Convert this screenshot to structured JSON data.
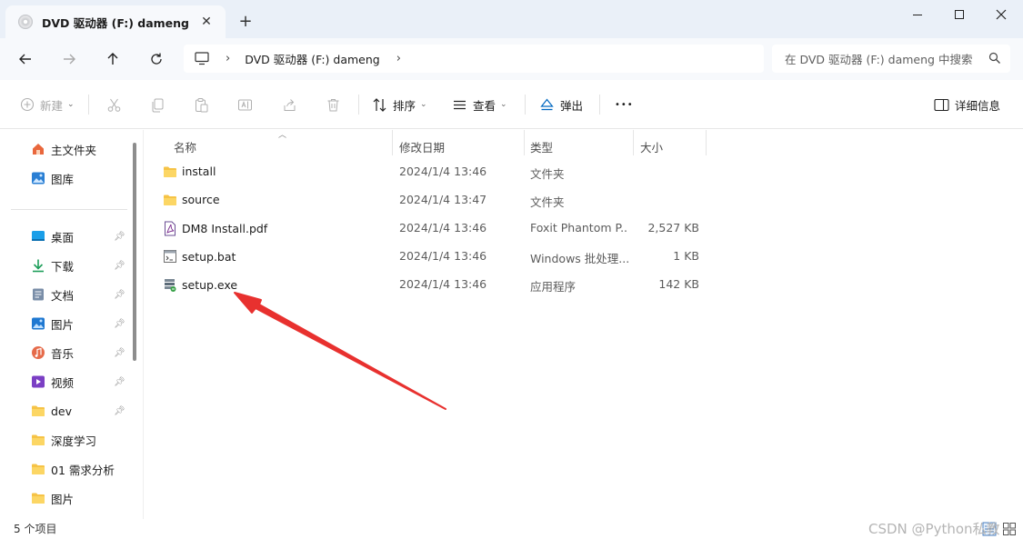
{
  "window": {
    "tab_title": "DVD 驱动器 (F:) dameng",
    "new_tab": "+",
    "close_tab": "✕"
  },
  "address": {
    "crumb": "DVD 驱动器 (F:) dameng",
    "search_placeholder": "在 DVD 驱动器 (F:) dameng 中搜索"
  },
  "toolbar": {
    "new_label": "新建",
    "sort_label": "排序",
    "view_label": "查看",
    "eject_label": "弹出",
    "more_label": "•••",
    "details_label": "详细信息"
  },
  "sidebar": {
    "top_items": [
      {
        "label": "主文件夹",
        "icon": "home-icon"
      },
      {
        "label": "图库",
        "icon": "gallery-icon"
      }
    ],
    "items": [
      {
        "label": "桌面",
        "icon": "desktop-icon",
        "pinned": true
      },
      {
        "label": "下载",
        "icon": "download-icon",
        "pinned": true
      },
      {
        "label": "文档",
        "icon": "document-icon",
        "pinned": true
      },
      {
        "label": "图片",
        "icon": "pictures-icon",
        "pinned": true
      },
      {
        "label": "音乐",
        "icon": "music-icon",
        "pinned": true
      },
      {
        "label": "视频",
        "icon": "video-icon",
        "pinned": true
      },
      {
        "label": "dev",
        "icon": "folder-icon",
        "pinned": true
      },
      {
        "label": "深度学习",
        "icon": "folder-icon",
        "pinned": false
      },
      {
        "label": "01 需求分析",
        "icon": "folder-icon",
        "pinned": false
      },
      {
        "label": "图片",
        "icon": "folder-icon",
        "pinned": false
      }
    ]
  },
  "columns": {
    "name": "名称",
    "date": "修改日期",
    "type": "类型",
    "size": "大小"
  },
  "files": [
    {
      "name": "install",
      "date": "2024/1/4 13:46",
      "type": "文件夹",
      "size": "",
      "icon": "folder-icon"
    },
    {
      "name": "source",
      "date": "2024/1/4 13:47",
      "type": "文件夹",
      "size": "",
      "icon": "folder-icon"
    },
    {
      "name": "DM8 Install.pdf",
      "date": "2024/1/4 13:46",
      "type": "Foxit Phantom P...",
      "size": "2,527 KB",
      "icon": "pdf-icon"
    },
    {
      "name": "setup.bat",
      "date": "2024/1/4 13:46",
      "type": "Windows 批处理...",
      "size": "1 KB",
      "icon": "batch-file-icon"
    },
    {
      "name": "setup.exe",
      "date": "2024/1/4 13:46",
      "type": "应用程序",
      "size": "142 KB",
      "icon": "setup-exe-icon"
    }
  ],
  "status": {
    "count": "5 个项目"
  },
  "watermark": "CSDN @Python私教",
  "colors": {
    "accent": "#0067c0",
    "folder": "#f6c346",
    "arrow": "#e8312f"
  }
}
